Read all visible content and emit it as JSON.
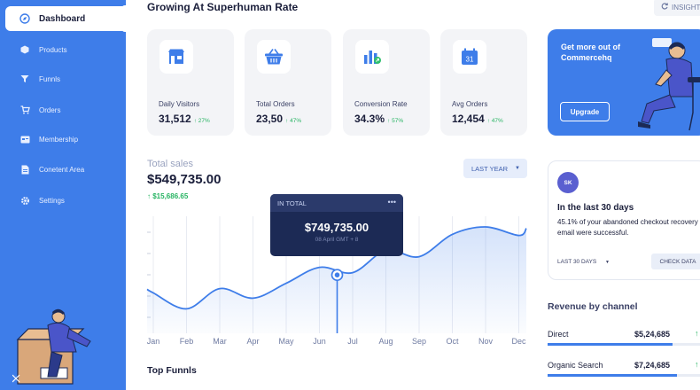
{
  "sidebar": {
    "items": [
      {
        "label": "Dashboard",
        "icon": "compass-icon"
      },
      {
        "label": "Products",
        "icon": "box-icon"
      },
      {
        "label": "Funnls",
        "icon": "funnel-icon"
      },
      {
        "label": "Orders",
        "icon": "cart-icon"
      },
      {
        "label": "Membership",
        "icon": "card-icon"
      },
      {
        "label": "Conetent Area",
        "icon": "document-icon"
      },
      {
        "label": "Settings",
        "icon": "gear-icon"
      }
    ]
  },
  "header": {
    "title": "Growing At Superhuman Rate",
    "insights_label": "INSIGHTS"
  },
  "stats": [
    {
      "label": "Daily Visitors",
      "value": "31,512",
      "change": "↑ 27%",
      "icon": "storefront-icon"
    },
    {
      "label": "Total Orders",
      "value": "23,50",
      "change": "↑ 47%",
      "icon": "basket-icon"
    },
    {
      "label": "Conversion Rate",
      "value": "34.3%",
      "change": "↑ 57%",
      "icon": "bar-chart-icon"
    },
    {
      "label": "Avg Orders",
      "value": "12,454",
      "change": "↑ 47%",
      "icon": "calendar-icon"
    }
  ],
  "promo": {
    "text": "Get more out of Commercehq",
    "button": "Upgrade"
  },
  "sales": {
    "label": "Total sales",
    "value": "$549,735.00",
    "change": "↑ $15,686.65",
    "period": "LAST YEAR",
    "tooltip": {
      "header": "IN TOTAL",
      "value": "$749,735.00",
      "date": "08 April GMT + 8"
    }
  },
  "chart_data": {
    "type": "line",
    "categories": [
      "Jan",
      "Feb",
      "Mar",
      "Apr",
      "May",
      "Jun",
      "Jul",
      "Aug",
      "Sep",
      "Oct",
      "Nov",
      "Dec"
    ],
    "series": [
      {
        "values": [
          0.38,
          0.23,
          0.42,
          0.33,
          0.47,
          0.62,
          0.57,
          0.78,
          0.72,
          0.93,
          1.0,
          0.92
        ]
      }
    ],
    "highlight_index": 5,
    "grid": "vertical",
    "accent": "#3e7de9"
  },
  "funnels": {
    "title": "Top Funnls"
  },
  "recovery": {
    "avatar": "SK",
    "title": "In the last 30 days",
    "body": "45.1% of your abandoned checkout recovery email were successful.",
    "period": "LAST 30 DAYS",
    "check_button": "CHECK DATA"
  },
  "revenue": {
    "title": "Revenue by channel",
    "rows": [
      {
        "name": "Direct",
        "value": "$5,24,685",
        "share": 0.82
      },
      {
        "name": "Organic Search",
        "value": "$7,24,685",
        "share": 0.85
      }
    ]
  },
  "colors": {
    "brand": "#3e7de9",
    "positive": "#28b463",
    "tooltip_bg": "#1c2a55"
  }
}
